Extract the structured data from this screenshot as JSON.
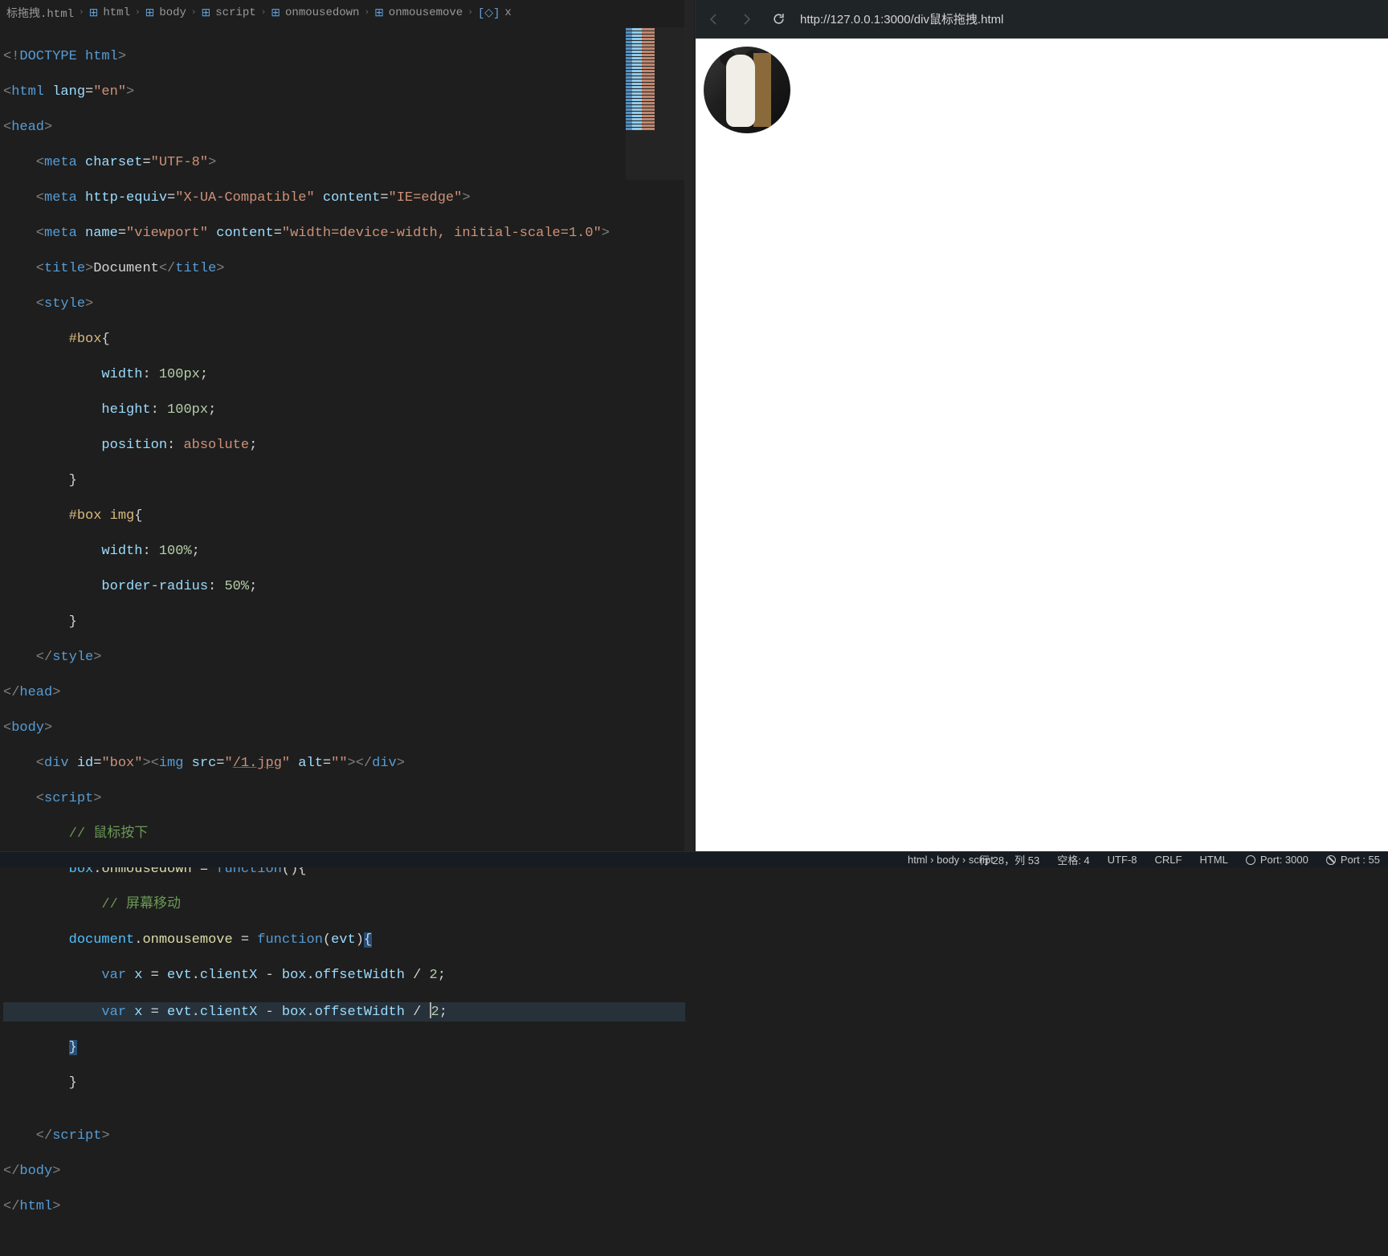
{
  "breadcrumb": {
    "file": "标拖拽.html",
    "items": [
      {
        "icon": "cube",
        "label": "html"
      },
      {
        "icon": "cube",
        "label": "body"
      },
      {
        "icon": "cube",
        "label": "script"
      },
      {
        "icon": "cube",
        "label": "onmousedown"
      },
      {
        "icon": "cube",
        "label": "onmousemove"
      },
      {
        "icon": "var",
        "label": "x"
      }
    ]
  },
  "code": {
    "l01_a": "<!",
    "l01_b": "DOCTYPE",
    "l01_c": " html",
    "l01_d": ">",
    "l02_a": "<",
    "l02_b": "html",
    "l02_c": " lang",
    "l02_d": "=",
    "l02_e": "\"en\"",
    "l02_f": ">",
    "l03_a": "<",
    "l03_b": "head",
    "l03_c": ">",
    "l04_a": "    <",
    "l04_b": "meta",
    "l04_c": " charset",
    "l04_d": "=",
    "l04_e": "\"UTF-8\"",
    "l04_f": ">",
    "l05_a": "    <",
    "l05_b": "meta",
    "l05_c": " http-equiv",
    "l05_d": "=",
    "l05_e": "\"X-UA-Compatible\"",
    "l05_f": " content",
    "l05_g": "=",
    "l05_h": "\"IE=edge\"",
    "l05_i": ">",
    "l06_a": "    <",
    "l06_b": "meta",
    "l06_c": " name",
    "l06_d": "=",
    "l06_e": "\"viewport\"",
    "l06_f": " content",
    "l06_g": "=",
    "l06_h": "\"width=device-width, initial-scale=1.0\"",
    "l06_i": ">",
    "l07_a": "    <",
    "l07_b": "title",
    "l07_c": ">",
    "l07_d": "Document",
    "l07_e": "</",
    "l07_f": "title",
    "l07_g": ">",
    "l08_a": "    <",
    "l08_b": "style",
    "l08_c": ">",
    "l09_a": "        ",
    "l09_b": "#box",
    "l09_c": "{",
    "l10_a": "            ",
    "l10_b": "width",
    "l10_c": ": ",
    "l10_d": "100px",
    "l10_e": ";",
    "l11_a": "            ",
    "l11_b": "height",
    "l11_c": ": ",
    "l11_d": "100px",
    "l11_e": ";",
    "l12_a": "            ",
    "l12_b": "position",
    "l12_c": ": ",
    "l12_d": "absolute",
    "l12_e": ";",
    "l13_a": "        }",
    "l14_a": "        ",
    "l14_b": "#box img",
    "l14_c": "{",
    "l15_a": "            ",
    "l15_b": "width",
    "l15_c": ": ",
    "l15_d": "100%",
    "l15_e": ";",
    "l16_a": "            ",
    "l16_b": "border-radius",
    "l16_c": ": ",
    "l16_d": "50%",
    "l16_e": ";",
    "l17_a": "        }",
    "l18_a": "    </",
    "l18_b": "style",
    "l18_c": ">",
    "l19_a": "</",
    "l19_b": "head",
    "l19_c": ">",
    "l20_a": "<",
    "l20_b": "body",
    "l20_c": ">",
    "l21_a": "    <",
    "l21_b": "div",
    "l21_c": " id",
    "l21_d": "=",
    "l21_e": "\"box\"",
    "l21_f": "><",
    "l21_g": "img",
    "l21_h": " src",
    "l21_i": "=",
    "l21_j": "\"",
    "l21_k": "/1.jpg",
    "l21_l": "\"",
    "l21_m": " alt",
    "l21_n": "=",
    "l21_o": "\"\"",
    "l21_p": "></",
    "l21_q": "div",
    "l21_r": ">",
    "l22_a": "    <",
    "l22_b": "script",
    "l22_c": ">",
    "l23_a": "        ",
    "l23_b": "// 鼠标按下",
    "l24_a": "        ",
    "l24_b": "box",
    "l24_c": ".",
    "l24_d": "onmousedown",
    "l24_e": " = ",
    "l24_f": "function",
    "l24_g": "(){",
    "l25_a": "            ",
    "l25_b": "// 屏幕移动",
    "l26_a": "        ",
    "l26_b": "document",
    "l26_c": ".",
    "l26_d": "onmousemove",
    "l26_e": " = ",
    "l26_f": "function",
    "l26_g": "(",
    "l26_h": "evt",
    "l26_i": ")",
    "l26_j": "{",
    "l27_a": "            ",
    "l27_b": "var",
    "l27_c": " ",
    "l27_d": "x",
    "l27_e": " = ",
    "l27_f": "evt",
    "l27_g": ".",
    "l27_h": "clientX",
    "l27_i": " - ",
    "l27_j": "box",
    "l27_k": ".",
    "l27_l": "offsetWidth",
    "l27_m": " / ",
    "l27_n": "2",
    "l27_o": ";",
    "l28_a": "            ",
    "l28_b": "var",
    "l28_c": " ",
    "l28_d": "x",
    "l28_e": " = ",
    "l28_f": "evt",
    "l28_g": ".",
    "l28_h": "clientX",
    "l28_i": " - ",
    "l28_j": "box",
    "l28_k": ".",
    "l28_l": "offsetWidth",
    "l28_m": " / ",
    "l28_n": "2",
    "l28_o": ";",
    "l29_a": "        ",
    "l29_b": "}",
    "l30_a": "        }",
    "l31_a": "",
    "l32_a": "    </",
    "l32_b": "script",
    "l32_c": ">",
    "l33_a": "</",
    "l33_b": "body",
    "l33_c": ">",
    "l34_a": "</",
    "l34_b": "html",
    "l34_c": ">"
  },
  "browser": {
    "url": "http://127.0.0.1:3000/div鼠标拖拽.html"
  },
  "status": {
    "path": "html › body › script",
    "cursor": "行 28，列 53",
    "spaces": "空格: 4",
    "encoding": "UTF-8",
    "eol": "CRLF",
    "lang": "HTML",
    "port": "Port: 3000",
    "port2": "Port : 55"
  }
}
